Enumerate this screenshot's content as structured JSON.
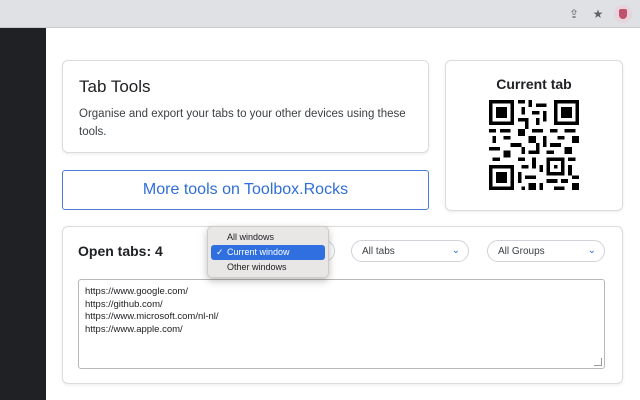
{
  "toolbar": {
    "share_icon": "share-icon",
    "star_icon": "star-icon",
    "extension_icon": "extension-icon"
  },
  "intro": {
    "title": "Tab Tools",
    "description": "Organise and export your tabs to your other devices using these tools."
  },
  "tools_button": {
    "label": "More tools on Toolbox.Rocks"
  },
  "qr": {
    "title": "Current tab"
  },
  "open_tabs": {
    "label": "Open tabs: ",
    "count": "4"
  },
  "window_select": {
    "options": [
      "All windows",
      "Current window",
      "Other windows"
    ],
    "selected": "Current window"
  },
  "tabs_select": {
    "selected": "All tabs"
  },
  "groups_select": {
    "selected": "All Groups"
  },
  "urls": [
    "https://www.google.com/",
    "https://github.com/",
    "https://www.microsoft.com/nl-nl/",
    "https://www.apple.com/"
  ],
  "colors": {
    "accent": "#2f6ed6",
    "menu_highlight": "#2f6fe0",
    "sidebar_dark": "#202124"
  }
}
